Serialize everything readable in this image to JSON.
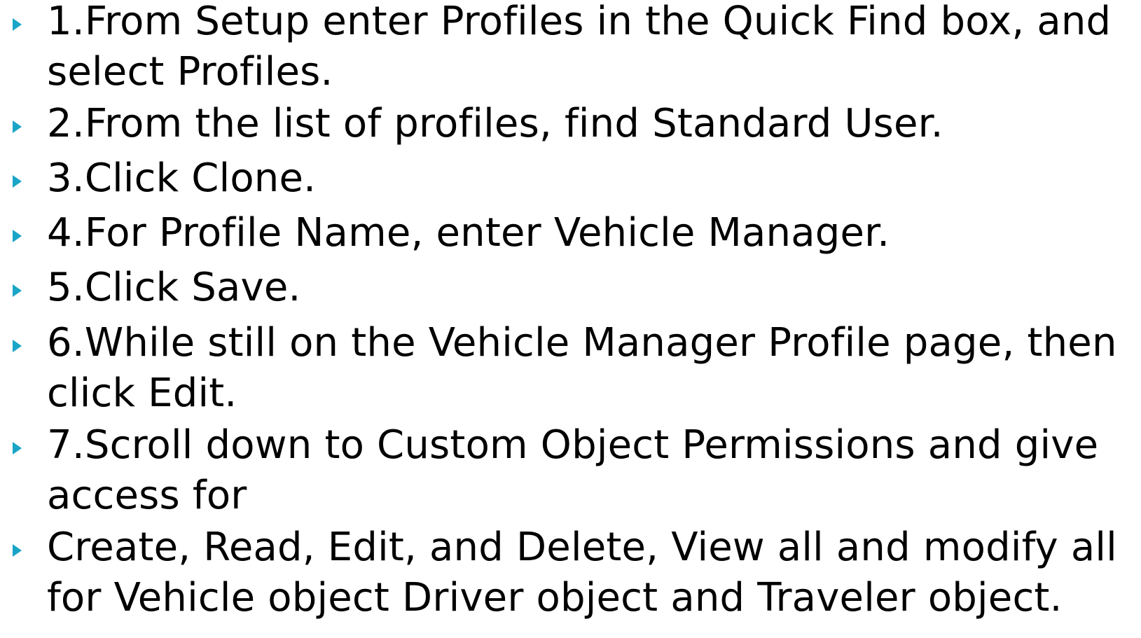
{
  "slide": {
    "accent_color": "#1aa5c7",
    "bullet_icon": "triangle-right-icon",
    "steps": [
      {
        "lines": [
          "1.From Setup enter Profiles in the Quick Find box, and",
          "select Profiles."
        ]
      },
      {
        "lines": [
          "2.From the list of profiles, find Standard User."
        ]
      },
      {
        "lines": [
          "3.Click Clone."
        ]
      },
      {
        "lines": [
          "4.For Profile Name, enter Vehicle Manager."
        ]
      },
      {
        "lines": [
          "5.Click Save."
        ]
      },
      {
        "lines": [
          "6.While still on the Vehicle Manager Profile page, then",
          "click Edit."
        ]
      },
      {
        "lines": [
          "7.Scroll down to Custom Object Permissions and give",
          "access for"
        ]
      },
      {
        "lines": [
          "Create, Read, Edit, and Delete, View all and modify all",
          "for Vehicle object Driver object and Traveler object."
        ]
      }
    ]
  }
}
